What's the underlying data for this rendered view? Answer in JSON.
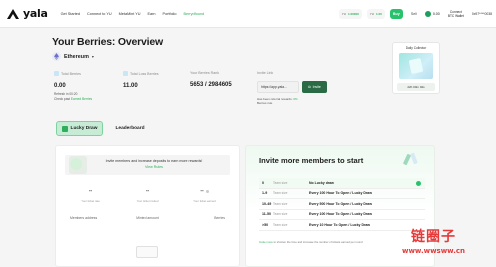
{
  "brand": {
    "name": "yala"
  },
  "nav": {
    "links": [
      "Get Started",
      "Connect to YU",
      "MetaMint YU",
      "Earn",
      "Portfolio",
      "Berrydfound"
    ],
    "active_index": 5,
    "stats": [
      {
        "label": "YU",
        "value": "1.00000"
      },
      {
        "label": "YU",
        "value": "1.00"
      }
    ],
    "buy_label": "Buy",
    "sell_label": "Sell",
    "chain_label": "0.00",
    "connect_label_line1": "Connect",
    "connect_label_line2": "BTC Wallet",
    "account_label": "0x97****0038"
  },
  "header": {
    "title": "Your Berries: Overview",
    "chain": "Ethereum"
  },
  "stats": [
    {
      "label": "Total Berries",
      "value": "0.00",
      "sub1": "Refresh in 00:20",
      "sub2_prefix": "Check past",
      "sub2_link": "Earned Berries"
    },
    {
      "label": "Total Loss Berries",
      "value": "11.00"
    },
    {
      "label": "Your Berries Rank",
      "value": "5653 / 2984605"
    }
  ],
  "invite": {
    "label": "Invite Link",
    "url_value": "https://app.yala...",
    "button_label": "Invite",
    "note_prefix": "Has been referral rewards:",
    "note_value": "0%",
    "note_line2": "Berries rule"
  },
  "collector": {
    "title": "Daily Collector",
    "button_label": "22h 00m 02s"
  },
  "tabs": [
    {
      "label": "Lucky Draw",
      "active": true
    },
    {
      "label": "Leaderboard",
      "active": false
    }
  ],
  "left_panel": {
    "promo_text": "Invite members and increase deposits to earn more rewards!",
    "promo_link": "View Rules",
    "mini_stats": [
      {
        "value": "--",
        "label": "Your ticket rate"
      },
      {
        "value": "--",
        "label": "Your ticket invited"
      },
      {
        "value": "--",
        "label": "Your ticket earned"
      }
    ],
    "columns": [
      "Members address",
      "Minted amount",
      "Berries"
    ]
  },
  "right_panel": {
    "title": "Invite more members to start",
    "tiers": [
      {
        "range": "0",
        "suffix": "Team size",
        "reward": "No Lucky draw",
        "current": true
      },
      {
        "range": "1-9",
        "suffix": "Team size",
        "reward": "Every 100 Hour To Open / Lucky Draw",
        "current": false
      },
      {
        "range": "10-49",
        "suffix": "Team size",
        "reward": "Every 500 Hour To Open / Lucky Draw",
        "current": false
      },
      {
        "range": "11-50",
        "suffix": "Team size",
        "reward": "Every 100 Hour To Open / Lucky Draw",
        "current": false
      },
      {
        "range": ">50",
        "suffix": "Team size",
        "reward": "Every 10 Hour To Open / Lucky Draw",
        "current": false
      }
    ],
    "note_link": "Invite more",
    "note_text": "to shorten the time and increase the number of tickets earned per round"
  },
  "watermark": {
    "cn": "链圈子",
    "url": "www.wwsww.cn"
  },
  "colors": {
    "accent": "#27c26b",
    "dark_green": "#2a6b46",
    "watermark": "#e53a3a"
  }
}
